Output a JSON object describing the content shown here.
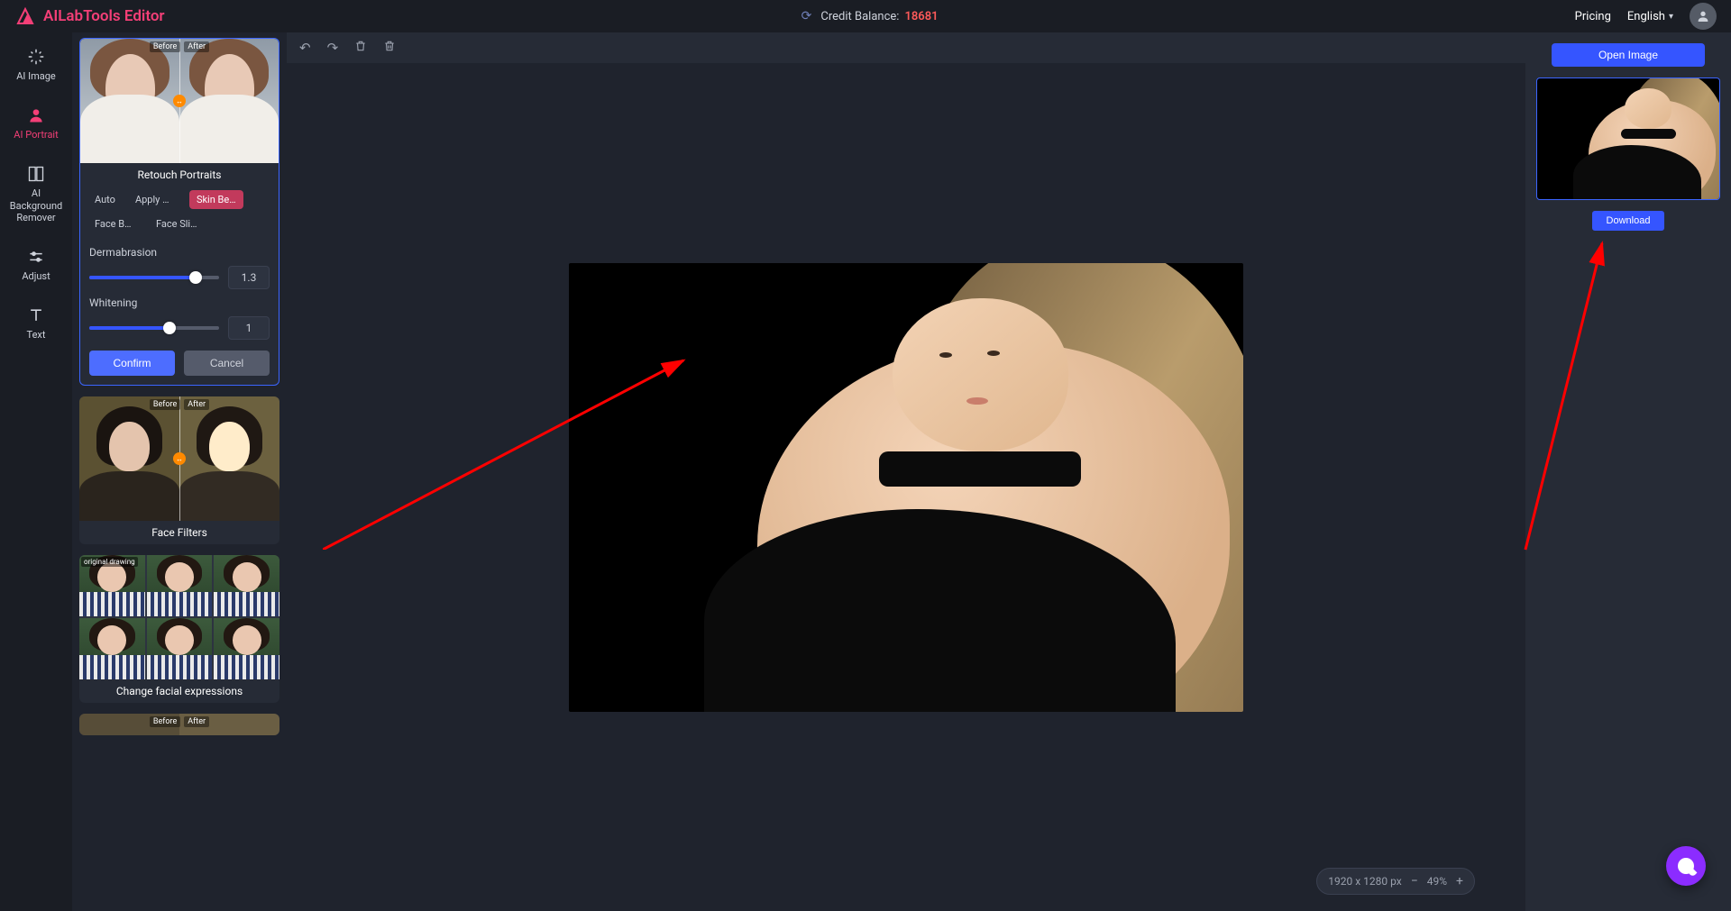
{
  "header": {
    "title": "AILabTools Editor",
    "credit_label": "Credit Balance:",
    "credit_value": "18681",
    "pricing": "Pricing",
    "language": "English"
  },
  "rail": [
    {
      "id": "ai-image",
      "label": "AI Image"
    },
    {
      "id": "ai-portrait",
      "label": "AI Portrait"
    },
    {
      "id": "ai-bg-remover",
      "label": "AI Background Remover"
    },
    {
      "id": "adjust",
      "label": "Adjust"
    },
    {
      "id": "text",
      "label": "Text"
    }
  ],
  "features": [
    {
      "id": "retouch",
      "title": "Retouch Portraits",
      "before": "Before",
      "after": "After"
    },
    {
      "id": "filters",
      "title": "Face Filters",
      "before": "Before",
      "after": "After"
    },
    {
      "id": "expressions",
      "title": "Change facial expressions",
      "orig": "original drawing"
    }
  ],
  "retouch": {
    "tabs": [
      "Auto",
      "Apply M…",
      "Skin Be…",
      "Face Be…",
      "Face Sli…"
    ],
    "active_tab_index": 2,
    "sliders": [
      {
        "id": "dermabrasion",
        "label": "Dermabrasion",
        "value": "1.3",
        "pct": 82
      },
      {
        "id": "whitening",
        "label": "Whitening",
        "value": "1",
        "pct": 62
      }
    ],
    "confirm": "Confirm",
    "cancel": "Cancel"
  },
  "canvas": {
    "dimensions": "1920 x 1280 px",
    "zoom": "49%"
  },
  "right": {
    "open": "Open Image",
    "download": "Download"
  }
}
